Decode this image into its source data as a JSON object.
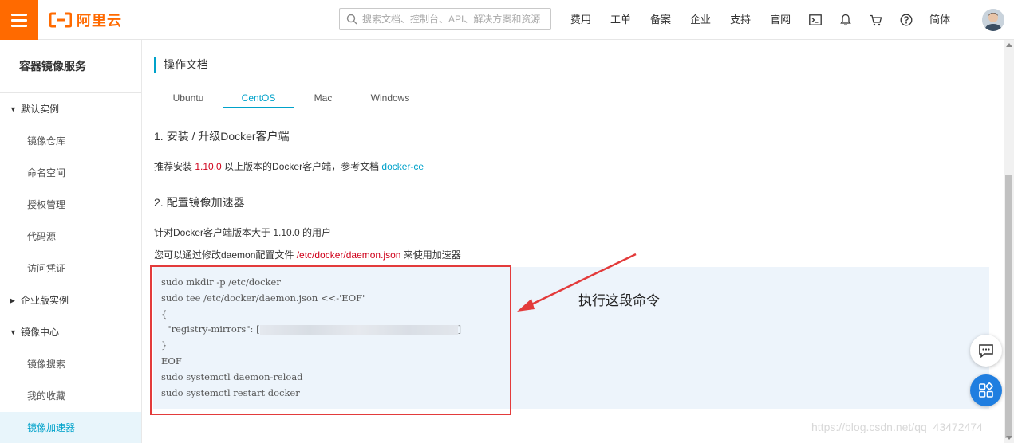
{
  "brand": {
    "name": "阿里云",
    "color": "#ff6a00"
  },
  "header": {
    "search_placeholder": "搜索文档、控制台、API、解决方案和资源",
    "nav_items": [
      "费用",
      "工单",
      "备案",
      "企业",
      "支持",
      "官网"
    ],
    "lang": "简体",
    "icons": [
      "terminal-icon",
      "bell-icon",
      "cart-icon",
      "help-icon"
    ]
  },
  "sidebar": {
    "title": "容器镜像服务",
    "groups": [
      {
        "label": "默认实例",
        "expanded": true,
        "items": [
          "镜像仓库",
          "命名空间",
          "授权管理",
          "代码源",
          "访问凭证"
        ]
      },
      {
        "label": "企业版实例",
        "expanded": false,
        "items": []
      },
      {
        "label": "镜像中心",
        "expanded": true,
        "items": [
          "镜像搜索",
          "我的收藏",
          "镜像加速器"
        ],
        "active": "镜像加速器"
      }
    ]
  },
  "main": {
    "section_title": "操作文档",
    "tabs": [
      "Ubuntu",
      "CentOS",
      "Mac",
      "Windows"
    ],
    "active_tab": "CentOS",
    "step1": {
      "title": "1. 安装 / 升级Docker客户端",
      "text_before": "推荐安装 ",
      "version": "1.10.0",
      "text_after": " 以上版本的Docker客户端，参考文档 ",
      "link": "docker-ce"
    },
    "step2": {
      "title": "2. 配置镜像加速器",
      "line1": "针对Docker客户端版本大于 1.10.0 的用户",
      "line2_before": "您可以通过修改daemon配置文件 ",
      "line2_path": "/etc/docker/daemon.json",
      "line2_after": " 来使用加速器"
    },
    "code_lines": [
      "sudo mkdir -p /etc/docker",
      "sudo tee /etc/docker/daemon.json <<-'EOF'",
      "{",
      "  \"registry-mirrors\": [",
      "}",
      "EOF",
      "sudo systemctl daemon-reload",
      "sudo systemctl restart docker"
    ],
    "code_line4_end": "]",
    "annotation": "执行这段命令"
  },
  "watermark": "https://blog.csdn.net/qq_43472474",
  "colors": {
    "accent": "#00a2ca",
    "highlight_red": "#e33b3b",
    "float_blue": "#1f7ee0"
  }
}
